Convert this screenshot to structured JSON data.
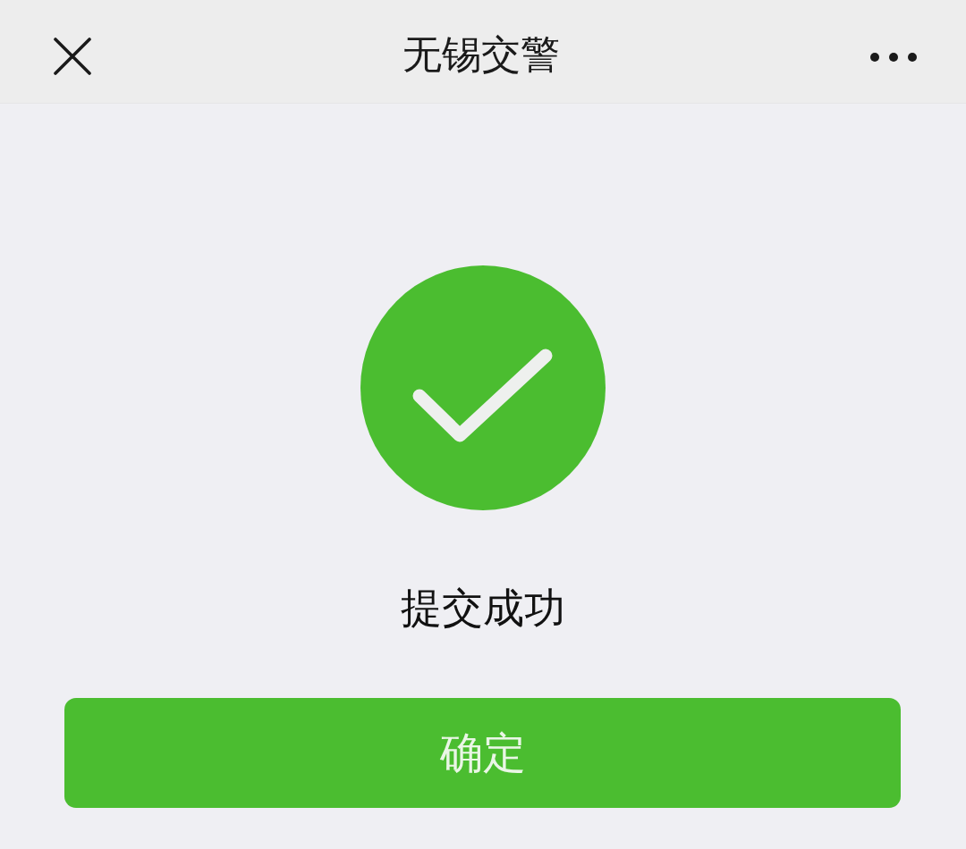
{
  "nav_bar": {
    "title": "无锡交警"
  },
  "result": {
    "kind": "success",
    "message": "提交成功"
  },
  "confirm_button": {
    "label": "确定"
  }
}
